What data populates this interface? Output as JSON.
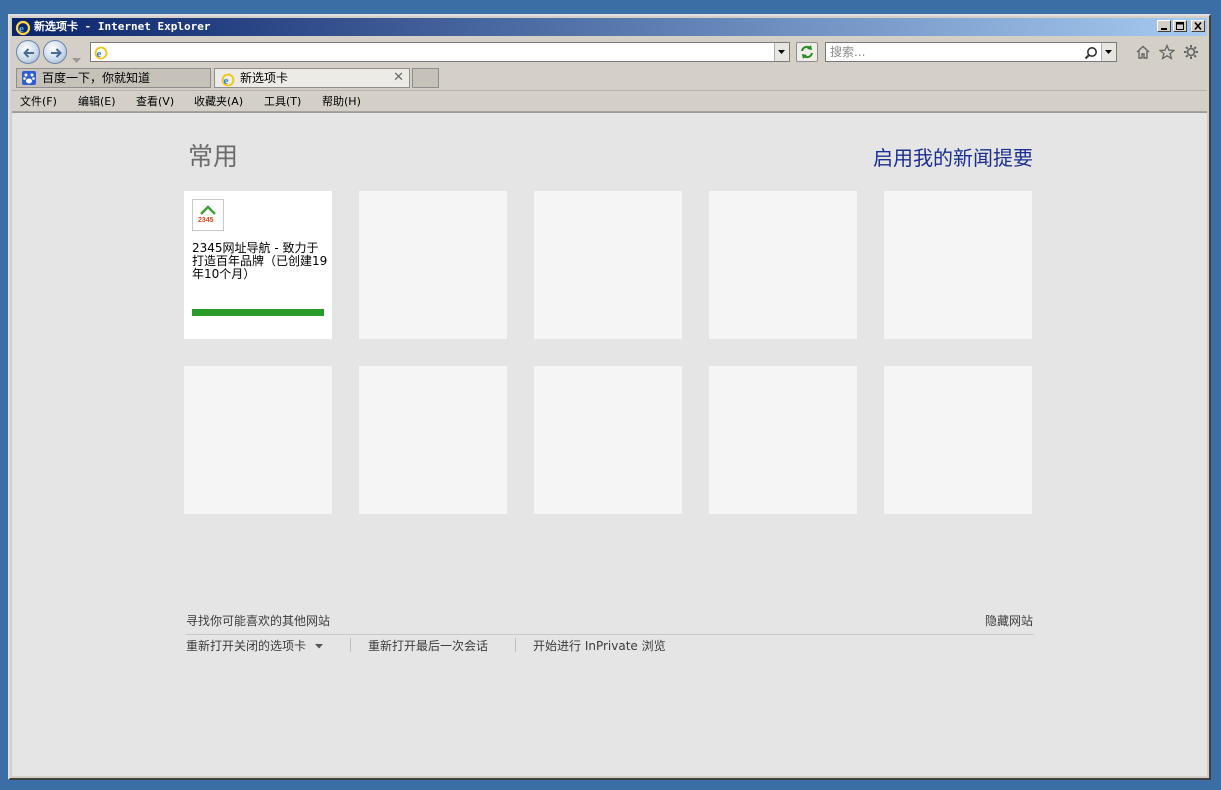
{
  "window": {
    "title": "新选项卡 - Internet Explorer"
  },
  "address": {
    "value": ""
  },
  "search": {
    "placeholder": "搜索..."
  },
  "tabs": [
    {
      "label": "百度一下，你就知道",
      "icon": "baidu-icon",
      "active": false
    },
    {
      "label": "新选项卡",
      "icon": "ie-icon",
      "active": true
    }
  ],
  "menu": {
    "items": [
      "文件(F)",
      "编辑(E)",
      "查看(V)",
      "收藏夹(A)",
      "工具(T)",
      "帮助(H)"
    ]
  },
  "page": {
    "heading": "常用",
    "news_link": "启用我的新闻提要",
    "tiles": [
      {
        "text": "2345网址导航 - 致力于打造百年品牌（已创建19年10个月）",
        "favicon": "2345-icon",
        "activity_fraction": 1.0
      }
    ],
    "footer": {
      "discover": "寻找你可能喜欢的其他网站",
      "hide": "隐藏网站",
      "reopen_closed": "重新打开关闭的选项卡",
      "reopen_session": "重新打开最后一次会话",
      "inprivate": "开始进行 InPrivate 浏览"
    }
  },
  "colors": {
    "desktop": "#3a6ea5",
    "accent_link": "#1d2e92",
    "usage_bar": "#2a9a2a"
  }
}
